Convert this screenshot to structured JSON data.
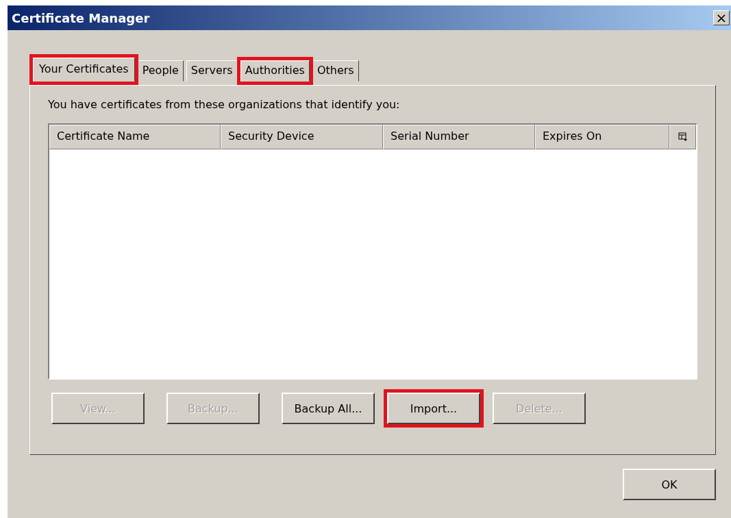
{
  "window": {
    "title": "Certificate Manager",
    "close": "×"
  },
  "tabs": [
    {
      "label": "Your Certificates",
      "selected": true,
      "highlighted": true
    },
    {
      "label": "People",
      "selected": false,
      "highlighted": false
    },
    {
      "label": "Servers",
      "selected": false,
      "highlighted": false
    },
    {
      "label": "Authorities",
      "selected": false,
      "highlighted": true
    },
    {
      "label": "Others",
      "selected": false,
      "highlighted": false
    }
  ],
  "description": "You have certificates from these organizations that identify you:",
  "table": {
    "columns": [
      "Certificate Name",
      "Security Device",
      "Serial Number",
      "Expires On"
    ]
  },
  "buttons": [
    {
      "label": "View...",
      "disabled": true,
      "highlighted": false
    },
    {
      "label": "Backup...",
      "disabled": true,
      "highlighted": false
    },
    {
      "label": "Backup All...",
      "disabled": false,
      "highlighted": false
    },
    {
      "label": "Import...",
      "disabled": false,
      "highlighted": true
    },
    {
      "label": "Delete...",
      "disabled": true,
      "highlighted": false
    }
  ],
  "ok_button": "OK"
}
